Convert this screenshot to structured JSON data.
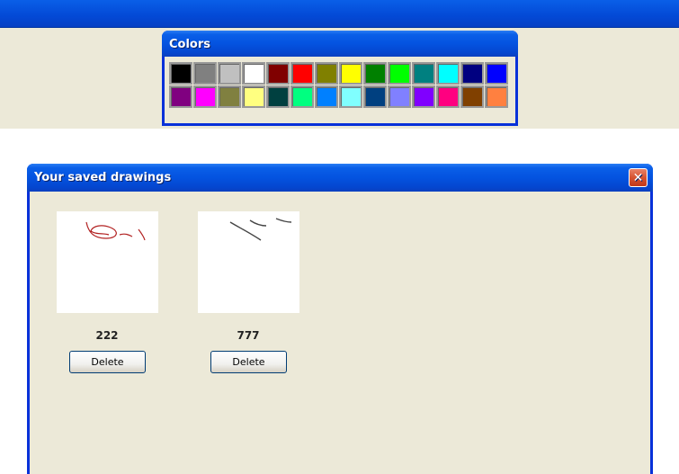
{
  "colors_window": {
    "title": "Colors",
    "palette": [
      "#000000",
      "#808080",
      "#c0c0c0",
      "#ffffff",
      "#800000",
      "#ff0000",
      "#808000",
      "#ffff00",
      "#008000",
      "#00ff00",
      "#008080",
      "#00ffff",
      "#000080",
      "#0000ff",
      "#800080",
      "#ff00ff",
      "#808040",
      "#ffff80",
      "#004040",
      "#00ff80",
      "#0080ff",
      "#80ffff",
      "#004080",
      "#8080ff",
      "#8000ff",
      "#ff0080",
      "#804000",
      "#ff8040"
    ]
  },
  "saved_window": {
    "title": "Your saved drawings",
    "close_label": "✕",
    "drawings": [
      {
        "name": "222",
        "delete_label": "Delete",
        "stroke_color": "#b22222"
      },
      {
        "name": "777",
        "delete_label": "Delete",
        "stroke_color": "#444444"
      }
    ]
  }
}
